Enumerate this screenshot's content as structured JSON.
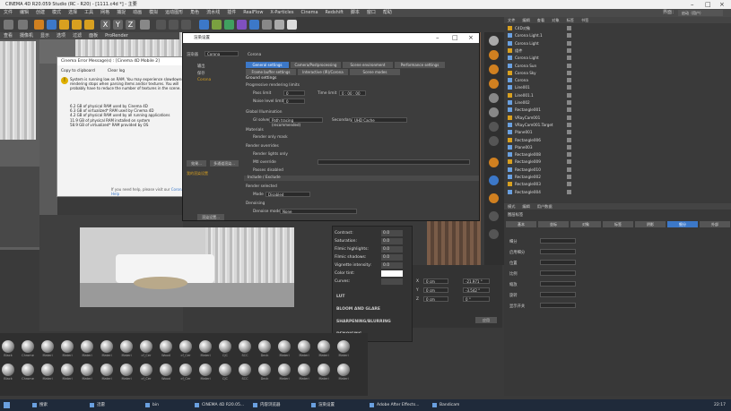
{
  "app": {
    "title": "CINEMA 4D R20.059 Studio (RC - R20) - [1111.c4d *] - 主要",
    "menus": [
      "文件",
      "编辑",
      "创建",
      "模式",
      "选择",
      "工具",
      "网格",
      "捕捉",
      "动画",
      "模拟",
      "运动图形",
      "角色",
      "流水线",
      "插件",
      "RealFlow",
      "X-Particles",
      "Cinema",
      "Redshift",
      "脚本",
      "窗口",
      "帮助"
    ],
    "interface_label": "界面：",
    "interface_value": "启动（用户）"
  },
  "viewport_menu": [
    "查看",
    "摄像机",
    "显示",
    "选项",
    "过滤",
    "面板",
    "ProRender"
  ],
  "error_dialog": {
    "title": "Cinema Error Message(s) : [Cinema 4D Mobile 2]",
    "copy_button": "Copy to clipboard",
    "clear_button": "Clear log",
    "message": "System is running low on RAM. You may experience slowdowns / rendering stops when parsing items and/or textures. You will probably have to reduce the number of textures in the scene.",
    "stats": [
      "6.2 GB of physical RAM used by Cinema 4D",
      "6.3 GB of virtualized* RAM used by Cinema 4D",
      "4.2 GB of physical RAM used by all running applications",
      "11.9 GB of physical RAM installed on system",
      "58.9 GB of virtualized* RAM provided by OS"
    ],
    "help_text": "If you need help, please visit our",
    "help_link": "Corona Help"
  },
  "render_settings": {
    "title": "渲染设置",
    "renderer_label": "渲染器",
    "renderer_value": "Corona",
    "left_list": [
      "输出",
      "保存",
      "Corona"
    ],
    "tabs_row1": [
      "General settings",
      "Camera/Postprocessing",
      "Scene environment",
      "Performance settings"
    ],
    "tabs_row2": [
      "Frame buffer settings",
      "Interactive (IR)/Corona",
      "Scene modes"
    ],
    "group_title": "Ground settings",
    "progressive_label": "Progressive rendering limits",
    "pass_limit_label": "Pass limit",
    "pass_limit_value": "0",
    "time_limit_label": "Time limit",
    "time_limit_value": "0 : 00 : 00",
    "noise_label": "Noise level limit",
    "noise_value": "0",
    "gi_label": "Global Illumination",
    "gi_solver_label": "GI solver",
    "gi_solver_value": "Path tracing (recommended)",
    "secondary_label": "Secondary solver",
    "secondary_value": "UHD Cache",
    "materials_label": "Materials",
    "render_only_label": "Render only mask",
    "render_overrides": "Render overrides",
    "lights_only": "Render lights only",
    "mtl_override": "Mtl override",
    "passes_label": "Passes disabled",
    "include_exclude": "Include / Exclude",
    "render_selected": "Render selected",
    "mode_label": "Mode",
    "mode_value": "Disabled",
    "denoising": "Denoising",
    "denoise_mode_label": "Denoise mode",
    "denoise_mode_value": "None",
    "effect_button": "效果...",
    "multi_pass_button": "多通道渲染...",
    "my_settings": "我的渲染设置",
    "render_settings_btn": "渲染设置..."
  },
  "post_panel": {
    "rows": [
      {
        "label": "Contrast:",
        "value": "0.0"
      },
      {
        "label": "Saturation:",
        "value": "0.0"
      },
      {
        "label": "Filmic highlights:",
        "value": "0.0"
      },
      {
        "label": "Filmic shadows:",
        "value": "0.0"
      },
      {
        "label": "Vignette intensity:",
        "value": "0.0"
      },
      {
        "label": "Color tint:",
        "value": ""
      },
      {
        "label": "Curves:",
        "value": ""
      }
    ],
    "sections": [
      "LUT",
      "BLOOM AND GLARE",
      "SHARPENING/BLURRING",
      "DENOISING"
    ],
    "rendering_pass": "Rendering pass 21"
  },
  "materials": [
    "Black",
    "Chrome",
    "Materi",
    "Materi",
    "Materi",
    "Materi",
    "Materi",
    "cf_Cer",
    "Wood",
    "cf_Cer",
    "Materi",
    "CJC",
    "SCC",
    "Deck",
    "Materi",
    "Materi",
    "Materi",
    "Materi"
  ],
  "object_manager": {
    "menu": [
      "文件",
      "编辑",
      "查看",
      "对象",
      "标签",
      "书签"
    ],
    "rows": [
      "C4D对象",
      "Corona Light.1",
      "Corona Light",
      "组件",
      "Corona Light",
      "Corona Sun",
      "Corona Sky",
      "Corona",
      "Line001",
      "Line001.1",
      "Line002",
      "Rectangle001",
      "VRayCam001",
      "VRayCam001.Target",
      "Plane001",
      "Rectangle006",
      "Plane003",
      "Rectangle008",
      "Rectangle009",
      "Rectangle010",
      "Rectangle002",
      "Rectangle003",
      "Rectangle004"
    ]
  },
  "attributes": {
    "menu": [
      "模式",
      "编辑",
      "用户数据"
    ],
    "title": "图层标签",
    "tabs": [
      "基本",
      "坐标",
      "对象",
      "标签",
      "阴影",
      "细分",
      "外部"
    ],
    "active_tab": "细分",
    "rows": [
      "细分",
      "启用细分",
      "位置",
      "比例",
      "缩放",
      "旋转",
      "显示开关"
    ]
  },
  "coords": {
    "rows": [
      {
        "axis": "X",
        "pos": "0 cm",
        "size": "-21.971 °"
      },
      {
        "axis": "Y",
        "pos": "0 cm",
        "size": "-3.542 °"
      },
      {
        "axis": "Z",
        "pos": "0 cm",
        "size": "0 °"
      }
    ],
    "apply": "应用"
  },
  "taskbar": {
    "search": "搜索",
    "items": [
      "迅雷",
      "bin",
      "CINEMA 4D R20.05...",
      "内容浏览器",
      "渲染设置",
      "Adobe After Effects...",
      "Bandicam"
    ],
    "time": "22:17"
  },
  "colors": {
    "accent": "#3c78c8",
    "ui_bg": "#3a3a3a"
  }
}
